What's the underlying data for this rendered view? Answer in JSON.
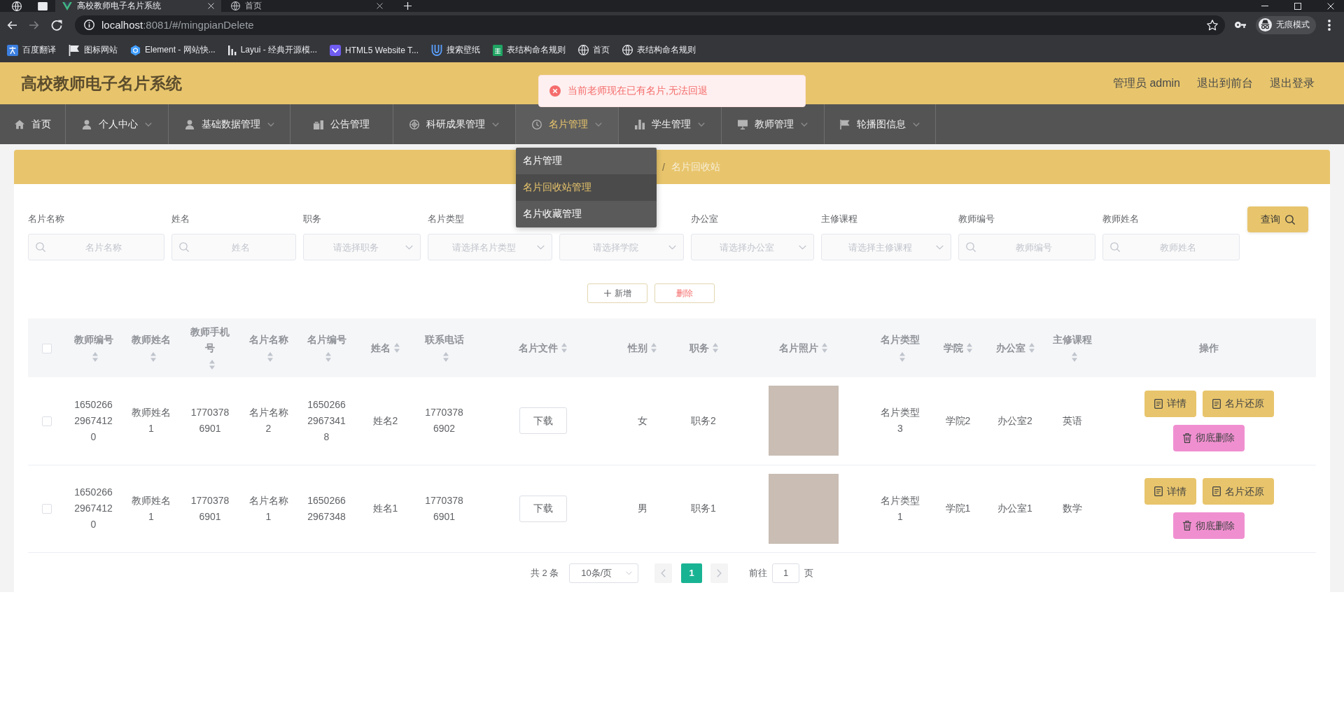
{
  "browser": {
    "tabs": [
      {
        "title": "高校教师电子名片系统",
        "selected": true
      },
      {
        "title": "首页",
        "selected": false
      }
    ],
    "url": {
      "host": "localhost",
      "path": ":8081/#/mingpianDelete"
    },
    "profile_label": "无痕模式",
    "bookmarks": [
      "百度翻译",
      "图标网站",
      "Element - 网站快...",
      "Layui - 经典开源模...",
      "HTML5 Website T...",
      "搜索壁纸",
      "表结构命名规则",
      "首页",
      "表结构命名规则"
    ]
  },
  "header": {
    "title": "高校教师电子名片系统",
    "links": [
      "管理员 admin",
      "退出到前台",
      "退出登录"
    ]
  },
  "toast": {
    "kind": "error",
    "message": "当前老师现在已有名片,无法回退"
  },
  "nav": {
    "items": [
      {
        "label": "首页",
        "selected": false,
        "submenu": false
      },
      {
        "label": "个人中心",
        "selected": false,
        "submenu": true
      },
      {
        "label": "基础数据管理",
        "selected": false,
        "submenu": true
      },
      {
        "label": "公告管理",
        "selected": false,
        "submenu": false
      },
      {
        "label": "科研成果管理",
        "selected": false,
        "submenu": true
      },
      {
        "label": "名片管理",
        "selected": true,
        "submenu": true
      },
      {
        "label": "学生管理",
        "selected": false,
        "submenu": true
      },
      {
        "label": "教师管理",
        "selected": false,
        "submenu": true
      },
      {
        "label": "轮播图信息",
        "selected": false,
        "submenu": true
      }
    ],
    "dropdown": {
      "items": [
        {
          "label": "名片管理",
          "selected": false
        },
        {
          "label": "名片回收站管理",
          "selected": true
        },
        {
          "label": "名片收藏管理",
          "selected": false
        }
      ]
    }
  },
  "breadcrumb": {
    "separator": "/",
    "current": "名片回收站"
  },
  "filters": {
    "fields": [
      {
        "label": "名片名称",
        "kind": "input",
        "placeholder": "名片名称"
      },
      {
        "label": "姓名",
        "kind": "input",
        "placeholder": "姓名"
      },
      {
        "label": "职务",
        "kind": "select",
        "placeholder": "请选择职务"
      },
      {
        "label": "名片类型",
        "kind": "select",
        "placeholder": "请选择名片类型"
      },
      {
        "kind": "select",
        "placeholder": "请选择学院"
      },
      {
        "label": "办公室",
        "kind": "select",
        "placeholder": "请选择办公室"
      },
      {
        "label": "主修课程",
        "kind": "select",
        "placeholder": "请选择主修课程"
      },
      {
        "label": "教师编号",
        "kind": "input",
        "placeholder": "教师编号"
      },
      {
        "label": "教师姓名",
        "kind": "input",
        "placeholder": "教师姓名"
      }
    ],
    "search_button": "查询"
  },
  "actions": [
    {
      "label": "新增",
      "kind": "add"
    },
    {
      "label": "删除",
      "kind": "delete"
    }
  ],
  "table": {
    "select_all": {
      "checked": false
    },
    "columns": [
      {
        "label": "教师编号",
        "sortable": true
      },
      {
        "label": "教师姓名",
        "sortable": true
      },
      {
        "label": "教师手机号",
        "sortable": true
      },
      {
        "label": "名片名称",
        "sortable": true
      },
      {
        "label": "名片编号",
        "sortable": true
      },
      {
        "label": "姓名",
        "sortable": true
      },
      {
        "label": "联系电话",
        "sortable": true
      },
      {
        "label": "名片文件",
        "sortable": true
      },
      {
        "label": "性别",
        "sortable": true
      },
      {
        "label": "职务",
        "sortable": true
      },
      {
        "label": "名片照片",
        "sortable": true
      },
      {
        "label": "名片类型",
        "sortable": true
      },
      {
        "label": "学院",
        "sortable": true
      },
      {
        "label": "办公室",
        "sortable": true
      },
      {
        "label": "主修课程",
        "sortable": true
      },
      {
        "label": "操作",
        "sortable": false
      }
    ],
    "rows": [
      {
        "selected": false,
        "cells": [
          {
            "kind": "text",
            "text": "165026629674120"
          },
          {
            "kind": "text",
            "text": "教师姓名1"
          },
          {
            "kind": "text",
            "text": "17703786901"
          },
          {
            "kind": "text",
            "text": "名片名称2"
          },
          {
            "kind": "text",
            "text": "165026629673418"
          },
          {
            "kind": "text",
            "text": "姓名2"
          },
          {
            "kind": "text",
            "text": "17703786902"
          },
          {
            "kind": "button",
            "text": "下载"
          },
          {
            "kind": "text",
            "text": "女"
          },
          {
            "kind": "text",
            "text": "职务2"
          },
          {
            "kind": "photo"
          },
          {
            "kind": "text",
            "text": "名片类型3"
          },
          {
            "kind": "text",
            "text": "学院2"
          },
          {
            "kind": "text",
            "text": "办公室2"
          },
          {
            "kind": "text",
            "text": "英语"
          },
          {
            "kind": "actions",
            "buttons": [
              {
                "label": "详情",
                "kind": "detail"
              },
              {
                "label": "名片还原",
                "kind": "restore"
              },
              {
                "label": "彻底删除",
                "kind": "delete"
              }
            ]
          }
        ]
      },
      {
        "selected": false,
        "cells": [
          {
            "kind": "text",
            "text": "165026629674120"
          },
          {
            "kind": "text",
            "text": "教师姓名1"
          },
          {
            "kind": "text",
            "text": "17703786901"
          },
          {
            "kind": "text",
            "text": "名片名称1"
          },
          {
            "kind": "text",
            "text": "16502662967348"
          },
          {
            "kind": "text",
            "text": "姓名1"
          },
          {
            "kind": "text",
            "text": "17703786901"
          },
          {
            "kind": "button",
            "text": "下载"
          },
          {
            "kind": "text",
            "text": "男"
          },
          {
            "kind": "text",
            "text": "职务1"
          },
          {
            "kind": "photo"
          },
          {
            "kind": "text",
            "text": "名片类型1"
          },
          {
            "kind": "text",
            "text": "学院1"
          },
          {
            "kind": "text",
            "text": "办公室1"
          },
          {
            "kind": "text",
            "text": "数学"
          },
          {
            "kind": "actions",
            "buttons": [
              {
                "label": "详情",
                "kind": "detail"
              },
              {
                "label": "名片还原",
                "kind": "restore"
              },
              {
                "label": "彻底删除",
                "kind": "delete"
              }
            ]
          }
        ]
      }
    ]
  },
  "pagination": {
    "total": "共 2 条",
    "page_size": "10条/页",
    "prev": {
      "disabled": true
    },
    "pages": [
      {
        "label": "1",
        "selected": true
      }
    ],
    "next": {
      "disabled": true
    },
    "goto_label": "前往",
    "goto_value": "1",
    "page_suffix": "页"
  }
}
